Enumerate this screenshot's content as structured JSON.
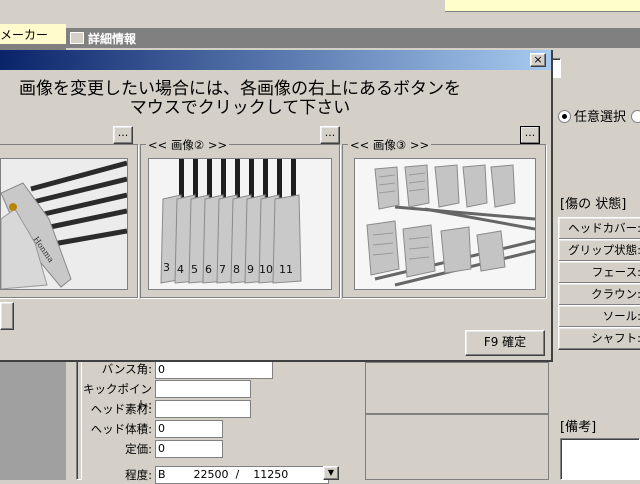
{
  "main": {
    "maker_label": "メーカー",
    "child_window_title": "詳細情報"
  },
  "dialog": {
    "message_line1": "画像を変更したい場合には、各画像の右上にあるボタンを",
    "message_line2": "マウスでクリックして下さい",
    "close_label": "×",
    "groups": [
      {
        "label": "",
        "button": "..."
      },
      {
        "label": "<< 画像② >>",
        "button": "..."
      },
      {
        "label": "<< 画像③ >>",
        "button": "..."
      }
    ],
    "confirm_button": "F9 確定"
  },
  "right_panel": {
    "radio_label": "任意選択",
    "damage_header": "[傷の 状態]",
    "items": [
      "ヘッドカバー:",
      "グリップ状態:",
      "フェース:",
      "クラウン:",
      "ソール:",
      "シャフト:"
    ],
    "remarks_header": "[備考]"
  },
  "form": {
    "fields": [
      {
        "label": "バンス角:",
        "value": "0"
      },
      {
        "label": "キックポイント:",
        "value": ""
      },
      {
        "label": "ヘッド素材:",
        "value": ""
      },
      {
        "label": "ヘッド体積:",
        "value": "0"
      },
      {
        "label": "定価:",
        "value": "0"
      }
    ],
    "grade_label": "程度:",
    "grade_value": "B        22500  /    11250"
  },
  "photos": {
    "iron_numbers": [
      "3",
      "4",
      "5",
      "6",
      "7",
      "8",
      "9",
      "10",
      "11"
    ]
  }
}
